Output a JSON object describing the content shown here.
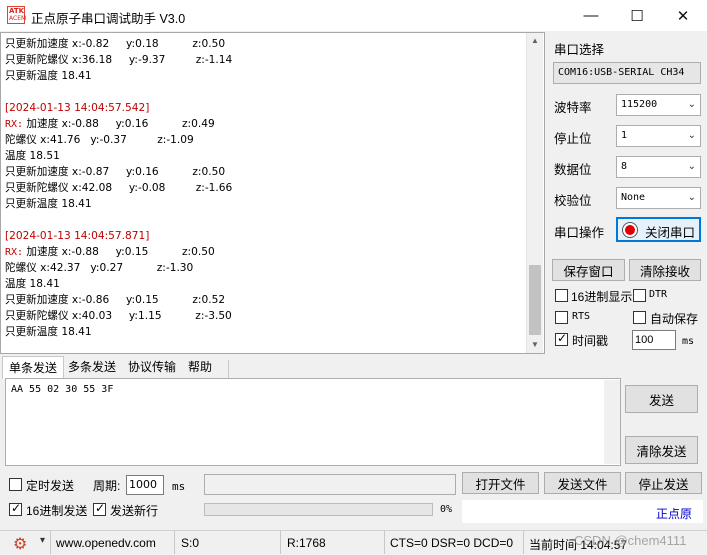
{
  "window": {
    "logo_line1": "ATK",
    "logo_line2": "ACEM",
    "title": "正点原子串口调试助手 V3.0",
    "minimize_icon": "—",
    "maximize_icon": "☐",
    "close_icon": "✕"
  },
  "receive_lines": [
    {
      "kind": "data",
      "text": "只更新加速度 x:-0.82     y:0.18          z:0.50"
    },
    {
      "kind": "data",
      "text": "只更新陀螺仪 x:36.18     y:-9.37         z:-1.14"
    },
    {
      "kind": "data",
      "text": "只更新温度 18.41"
    },
    {
      "kind": "blank",
      "text": ""
    },
    {
      "kind": "ts",
      "text": "[2024-01-13 14:04:57.542]"
    },
    {
      "kind": "rx",
      "prefix": "RX:",
      "text": " 加速度 x:-0.88     y:0.16          z:0.49"
    },
    {
      "kind": "data",
      "text": "陀螺仪 x:41.76   y:-0.37         z:-1.09"
    },
    {
      "kind": "data",
      "text": "温度 18.51"
    },
    {
      "kind": "data",
      "text": "只更新加速度 x:-0.87     y:0.16          z:0.50"
    },
    {
      "kind": "data",
      "text": "只更新陀螺仪 x:42.08     y:-0.08         z:-1.66"
    },
    {
      "kind": "data",
      "text": "只更新温度 18.41"
    },
    {
      "kind": "blank",
      "text": ""
    },
    {
      "kind": "ts",
      "text": "[2024-01-13 14:04:57.871]"
    },
    {
      "kind": "rx",
      "prefix": "RX:",
      "text": " 加速度 x:-0.88     y:0.15          z:0.50"
    },
    {
      "kind": "data",
      "text": "陀螺仪 x:42.37   y:0.27          z:-1.30"
    },
    {
      "kind": "data",
      "text": "温度 18.41"
    },
    {
      "kind": "data",
      "text": "只更新加速度 x:-0.86     y:0.15          z:0.52"
    },
    {
      "kind": "data",
      "text": "只更新陀螺仪 x:40.03     y:1.15          z:-3.50"
    },
    {
      "kind": "data",
      "text": "只更新温度 18.41"
    }
  ],
  "serial": {
    "port_select_label": "串口选择",
    "port_value": "COM16:USB-SERIAL CH34",
    "baud_label": "波特率",
    "baud_value": "115200",
    "stopbits_label": "停止位",
    "stopbits_value": "1",
    "databits_label": "数据位",
    "databits_value": "8",
    "parity_label": "校验位",
    "parity_value": "None",
    "port_op_label": "串口操作",
    "close_port_button": "关闭串口",
    "save_window_button": "保存窗口",
    "clear_receive_button": "清除接收",
    "hex_display_label": "16进制显示",
    "dtr_label": "DTR",
    "rts_label": "RTS",
    "auto_save_label": "自动保存",
    "timestamp_label": "时间戳",
    "timestamp_value": "100",
    "timestamp_unit": "ms",
    "hex_display_checked": false,
    "dtr_checked": false,
    "rts_checked": false,
    "auto_save_checked": false,
    "timestamp_checked": true
  },
  "tabs": [
    "单条发送",
    "多条发送",
    "协议传输",
    "帮助"
  ],
  "send": {
    "text": "AA 55 02 30 55 3F",
    "send_button": "发送",
    "clear_send_button": "清除发送",
    "timed_send_label": "定时发送",
    "period_label": "周期:",
    "period_value": "1000",
    "period_unit": "ms",
    "open_file_button": "打开文件",
    "send_file_button": "发送文件",
    "stop_send_button": "停止发送",
    "hex_send_label": "16进制发送",
    "send_newline_label": "发送新行",
    "progress_text": "0%",
    "progress": 0,
    "timed_send_checked": false,
    "hex_send_checked": true,
    "send_newline_checked": true,
    "brand_link": "正点原"
  },
  "status": {
    "gear_icon": "⚙",
    "dropdown_icon": "▾",
    "website": "www.openedv.com",
    "sent": "S:0",
    "received": "R:1768",
    "lines": "CTS=0 DSR=0 DCD=0",
    "time": "当前时间 14:04:57",
    "watermark": "CSDN @chem4111"
  },
  "colors": {
    "timestamp": "#c00000",
    "focus_border": "#0078d7",
    "port_indicator": "#e00000",
    "brand_link": "#0000cc"
  }
}
